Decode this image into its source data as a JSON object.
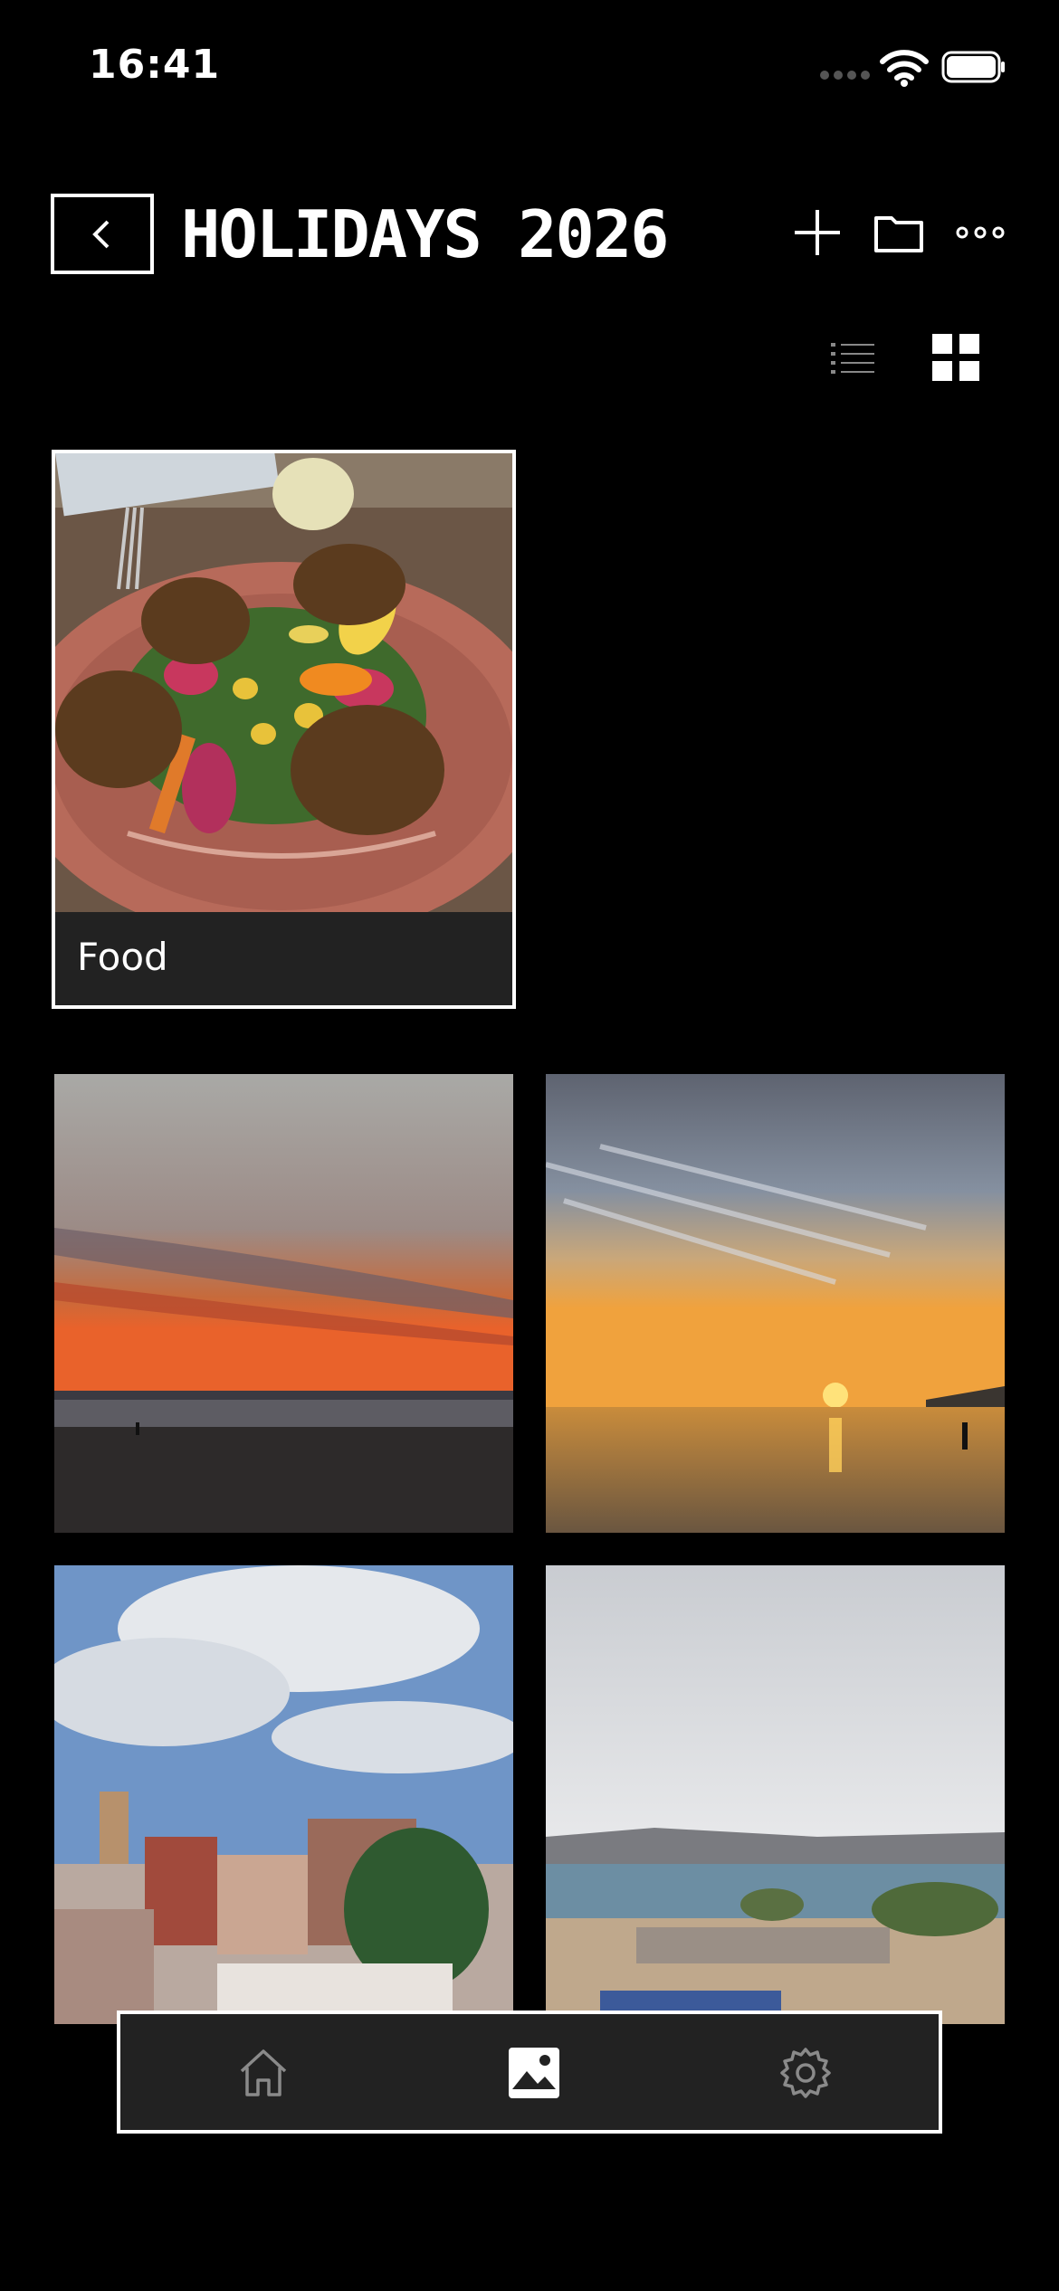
{
  "status_bar": {
    "time": "16:41",
    "icons": [
      "cellular-signal-icon",
      "wifi-icon",
      "battery-icon"
    ]
  },
  "header": {
    "title": "HOLIDAYS 2026",
    "actions": [
      "back-chevron-icon",
      "plus-icon",
      "folder-icon",
      "more-dots-icon"
    ]
  },
  "view_toggle": {
    "options": [
      "list-view-icon",
      "grid-view-icon"
    ],
    "selected": "grid"
  },
  "albums": [
    {
      "label": "Food",
      "thumbnail": "falafel salad plate"
    }
  ],
  "photos": [
    {
      "name": "sunset over beach with town"
    },
    {
      "name": "sunset over sea with person"
    },
    {
      "name": "town with minaret under clouds"
    },
    {
      "name": "overcast coastline"
    }
  ],
  "tab_bar": {
    "items": [
      "home-icon",
      "gallery-icon",
      "settings-gear-icon"
    ],
    "active": "gallery"
  },
  "colors": {
    "background": "#000000",
    "surface": "#222222",
    "border": "#ffffff",
    "inactive_icon": "#8a8a8a"
  }
}
